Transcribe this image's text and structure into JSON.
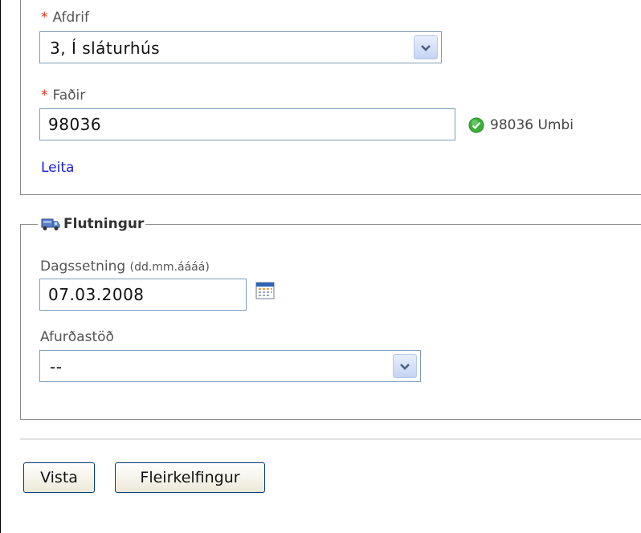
{
  "afdrif": {
    "label": "Afdrif",
    "required_mark": "*",
    "value": "3, Í sláturhús"
  },
  "fadir": {
    "label": "Faðir",
    "required_mark": "*",
    "value": "98036",
    "status_text": "98036 Umbi",
    "search_link": "Leita"
  },
  "flutningur": {
    "legend": "Flutningur",
    "date_label": "Dagssetning",
    "date_hint": "(dd.mm.áááá)",
    "date_value": "07.03.2008",
    "station_label": "Afurðastöð",
    "station_value": "--"
  },
  "buttons": {
    "save": "Vista",
    "more": "Fleirkelfingur"
  },
  "colors": {
    "required": "#e0301e",
    "link": "#1b1be0",
    "ok_icon": "#3cae3c"
  },
  "icons": [
    "chevron-down-icon",
    "check-circle-icon",
    "truck-icon",
    "calendar-icon"
  ]
}
